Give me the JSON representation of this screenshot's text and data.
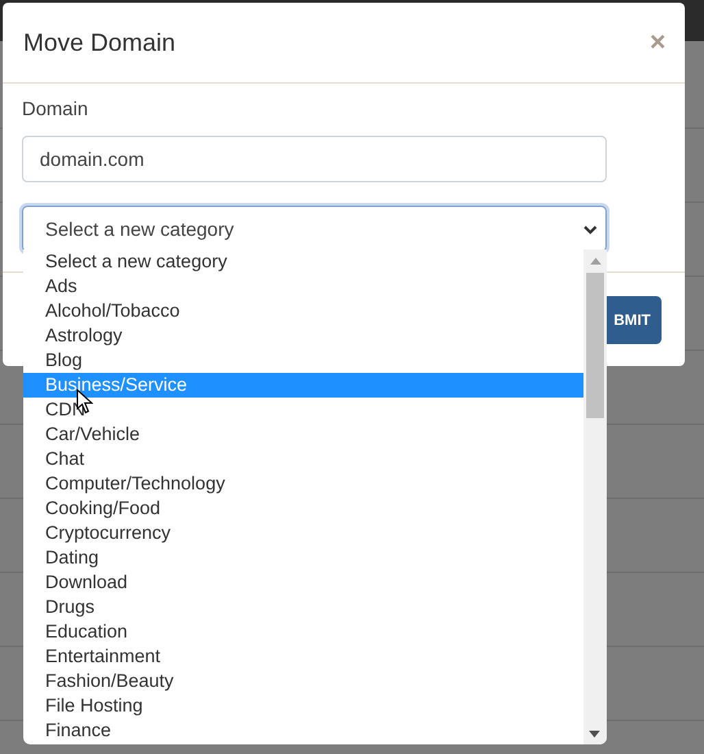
{
  "dialog": {
    "title": "Move Domain",
    "close": "×",
    "domain_label": "Domain",
    "domain_value": "domain.com",
    "category_select": "Select a new category",
    "submit_button": "BMIT"
  },
  "dropdown": {
    "options": [
      {
        "label": "Select a new category",
        "selected": false
      },
      {
        "label": "Ads",
        "selected": false
      },
      {
        "label": "Alcohol/Tobacco",
        "selected": false
      },
      {
        "label": "Astrology",
        "selected": false
      },
      {
        "label": "Blog",
        "selected": false
      },
      {
        "label": "Business/Service",
        "selected": true
      },
      {
        "label": "CDN",
        "selected": false
      },
      {
        "label": "Car/Vehicle",
        "selected": false
      },
      {
        "label": "Chat",
        "selected": false
      },
      {
        "label": "Computer/Technology",
        "selected": false
      },
      {
        "label": "Cooking/Food",
        "selected": false
      },
      {
        "label": "Cryptocurrency",
        "selected": false
      },
      {
        "label": "Dating",
        "selected": false
      },
      {
        "label": "Download",
        "selected": false
      },
      {
        "label": "Drugs",
        "selected": false
      },
      {
        "label": "Education",
        "selected": false
      },
      {
        "label": "Entertainment",
        "selected": false
      },
      {
        "label": "Fashion/Beauty",
        "selected": false
      },
      {
        "label": "File Hosting",
        "selected": false
      },
      {
        "label": "Finance",
        "selected": false
      }
    ]
  }
}
